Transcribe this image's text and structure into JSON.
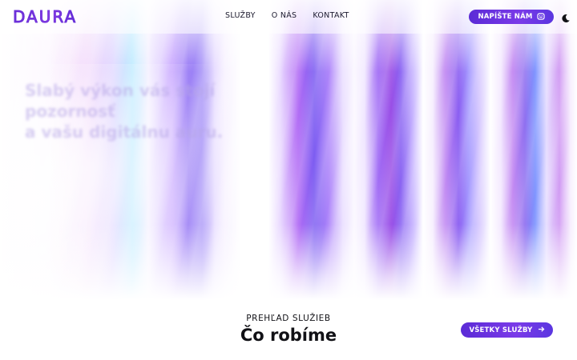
{
  "header": {
    "logo": "DAURA",
    "nav": [
      {
        "label": "SLUŽBY"
      },
      {
        "label": "O NÁS"
      },
      {
        "label": "KONTAKT"
      }
    ],
    "cta_label": "NAPÍŠTE NÁM",
    "cta_icon": "chat-icon",
    "theme_toggle_icon": "moon-icon"
  },
  "hero": {
    "title_lines": [
      "Slabý výkon vás stojí",
      "pozornosť",
      "a vašu digitálnu auru."
    ]
  },
  "services": {
    "eyebrow": "PREHĽAD SLUŽIEB",
    "title": "Čo robíme",
    "all_services_label": "VŠETKY SLUŽBY",
    "all_services_icon": "arrow-right-icon"
  },
  "colors": {
    "brand": "#6a2fd8",
    "brand_gradient_end": "#7a3ae8",
    "text": "#111116"
  }
}
